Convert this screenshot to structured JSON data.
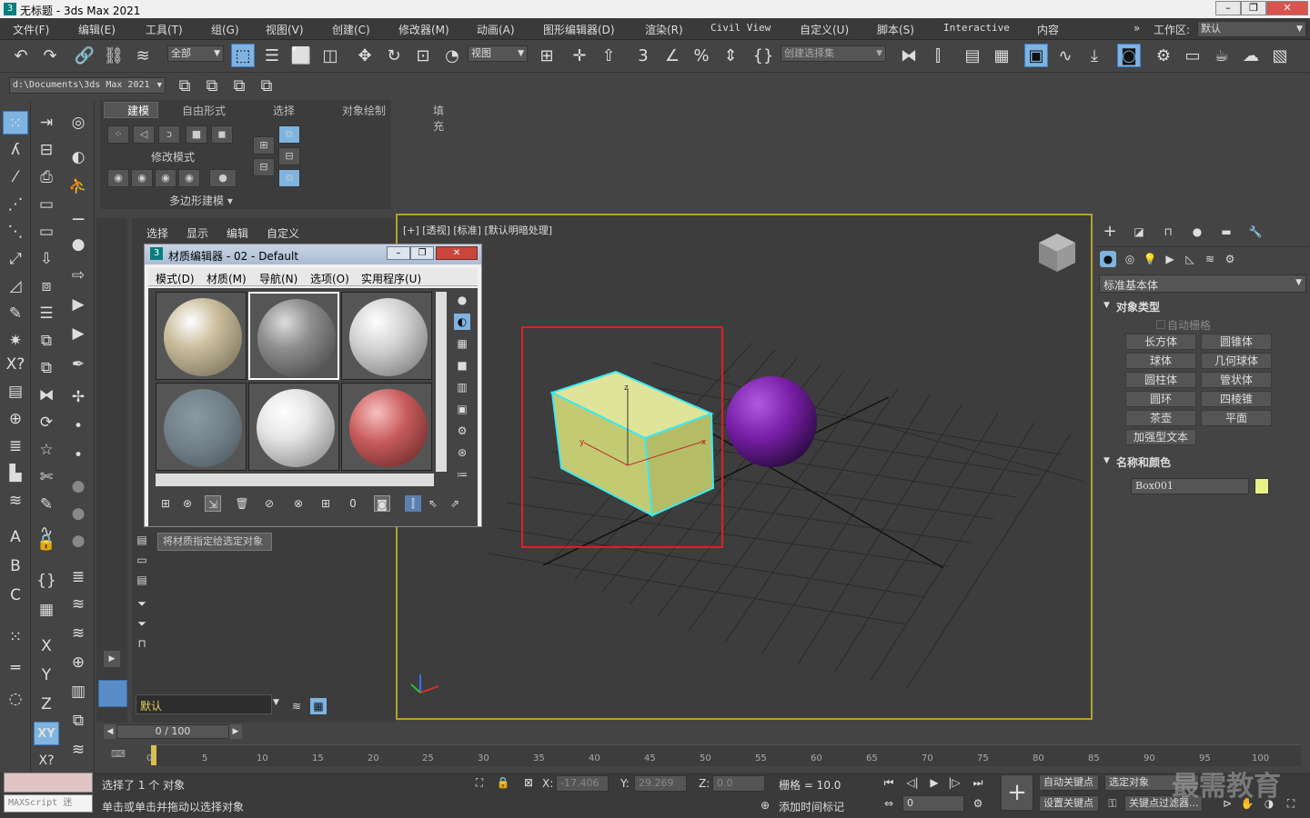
{
  "window": {
    "title": "无标题 - 3ds Max 2021",
    "app_icon": "3"
  },
  "menubar": {
    "items": [
      "文件(F)",
      "编辑(E)",
      "工具(T)",
      "组(G)",
      "视图(V)",
      "创建(C)",
      "修改器(M)",
      "动画(A)",
      "图形编辑器(D)",
      "渲染(R)",
      "Civil View",
      "自定义(U)",
      "脚本(S)",
      "Interactive",
      "内容"
    ],
    "workspace_label": "工作区:",
    "workspace_value": "默认"
  },
  "toolbar": {
    "filter_value": "全部",
    "ref_coord_value": "视图",
    "selection_set_placeholder": "创建选择集",
    "path_value": "d:\\Documents\\3ds Max 2021"
  },
  "ribbon": {
    "tabs": [
      "建模",
      "自由形式",
      "选择",
      "对象绘制",
      "填充"
    ],
    "modify_mode_label": "修改模式",
    "poly_modeling_label": "多边形建模 ▾"
  },
  "explorer": {
    "menu": [
      "选择",
      "显示",
      "编辑",
      "自定义"
    ],
    "layer_value": "默认"
  },
  "material_editor": {
    "title": "材质编辑器 - 02 - Default",
    "menu": [
      "模式(D)",
      "材质(M)",
      "导航(N)",
      "选项(O)",
      "实用程序(U)"
    ],
    "tooltip": "将材质指定给选定对象",
    "slot_colors": [
      "#cbbf9e",
      "#8f8f8f",
      "#cfcfcf",
      "#6f7d86",
      "#e6e6e6",
      "#c85c5c"
    ]
  },
  "viewport": {
    "label": "[+] [透视] [标准] [默认明暗处理]",
    "box_name": "Box001",
    "box_color": "#c8d27a",
    "sphere_color": "#7a1fa8"
  },
  "command_panel": {
    "category_value": "标准基本体",
    "object_type_header": "对象类型",
    "autogrid_label": "自动栅格",
    "buttons": [
      "长方体",
      "圆锥体",
      "球体",
      "几何球体",
      "圆柱体",
      "管状体",
      "圆环",
      "四棱锥",
      "茶壶",
      "平面",
      "加强型文本"
    ],
    "name_color_header": "名称和颜色",
    "object_name": "Box001",
    "object_color": "#e8f08a"
  },
  "timeline": {
    "frame_display": "0 / 100",
    "ticks": [
      "0",
      "5",
      "10",
      "15",
      "20",
      "25",
      "30",
      "35",
      "40",
      "45",
      "50",
      "55",
      "60",
      "65",
      "70",
      "75",
      "80",
      "85",
      "90",
      "95",
      "100"
    ]
  },
  "status": {
    "selected_text": "选择了 1 个 对象",
    "prompt_text": "单击或单击并拖动以选择对象",
    "maxscript_label": "MAXScript 迷",
    "x_label": "X:",
    "x_value": "-17.406",
    "y_label": "Y:",
    "y_value": "29.269",
    "z_label": "Z:",
    "z_value": "0.0",
    "grid_text": "栅格 = 10.0",
    "add_time_tag": "添加时间标记",
    "auto_key": "自动关键点",
    "selected_object": "选定对象",
    "set_key": "设置关键点",
    "key_filter": "关键点过滤器...",
    "frame_value": "0",
    "watermark": "最需教育"
  }
}
